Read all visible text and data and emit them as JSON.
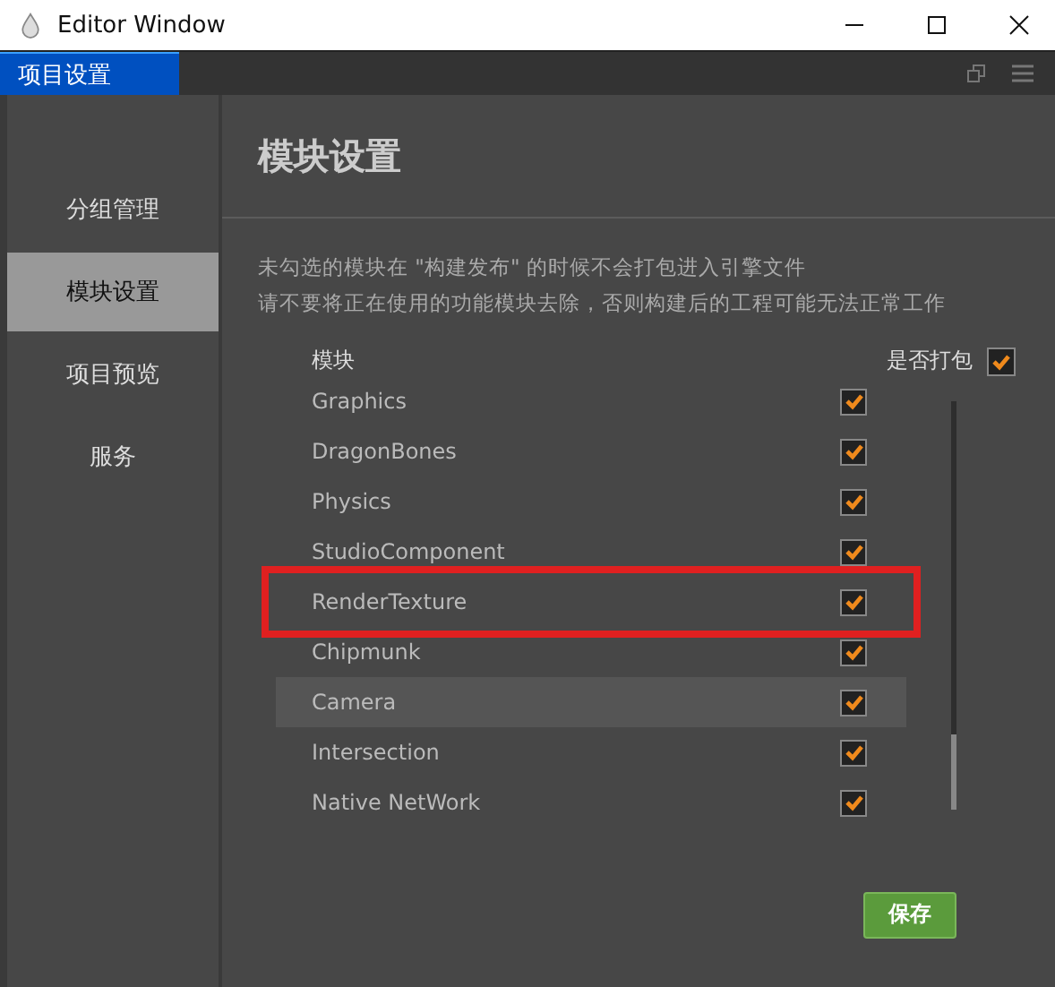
{
  "window": {
    "title": "Editor Window"
  },
  "tabs": [
    {
      "label": "项目设置",
      "selected": true
    }
  ],
  "sidebar": {
    "items": [
      {
        "label": "分组管理",
        "selected": false
      },
      {
        "label": "模块设置",
        "selected": true
      },
      {
        "label": "项目预览",
        "selected": false
      },
      {
        "label": "服务",
        "selected": false
      }
    ]
  },
  "panel": {
    "title": "模块设置",
    "notes": [
      "未勾选的模块在 \"构建发布\" 的时候不会打包进入引擎文件",
      "请不要将正在使用的功能模块去除，否则构建后的工程可能无法正常工作"
    ],
    "columns": [
      "模块",
      "是否打包"
    ],
    "select_all": {
      "checked": true
    },
    "modules": [
      {
        "name": "Graphics",
        "checked": true,
        "selected": false,
        "annotated": false
      },
      {
        "name": "DragonBones",
        "checked": true,
        "selected": false,
        "annotated": false
      },
      {
        "name": "Physics",
        "checked": true,
        "selected": false,
        "annotated": false
      },
      {
        "name": "StudioComponent",
        "checked": true,
        "selected": false,
        "annotated": false
      },
      {
        "name": "RenderTexture",
        "checked": true,
        "selected": false,
        "annotated": true
      },
      {
        "name": "Chipmunk",
        "checked": true,
        "selected": false,
        "annotated": false
      },
      {
        "name": "Camera",
        "checked": true,
        "selected": true,
        "annotated": false
      },
      {
        "name": "Intersection",
        "checked": true,
        "selected": false,
        "annotated": false
      },
      {
        "name": "Native NetWork",
        "checked": true,
        "selected": false,
        "annotated": false
      }
    ],
    "save_button": "保存"
  }
}
